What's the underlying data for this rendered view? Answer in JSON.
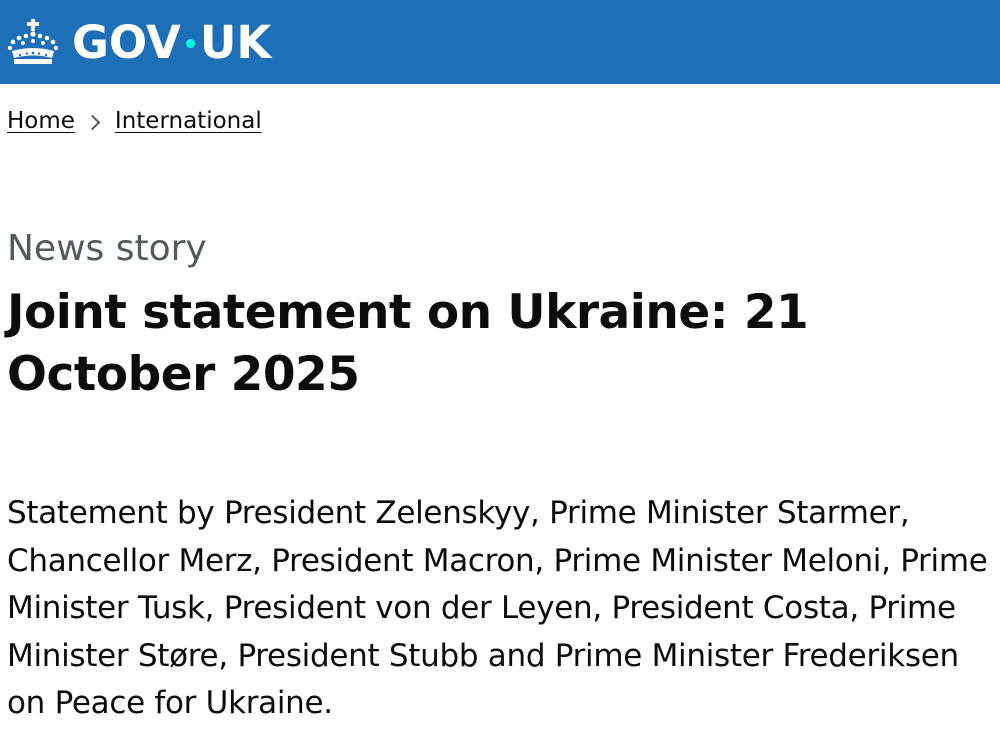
{
  "header": {
    "logo_text_left": "GOV",
    "logo_text_right": "UK",
    "crown_icon": "crown-icon",
    "colors": {
      "header_bg": "#1d70b8",
      "logo_dot": "#00ffe0",
      "text": "#0b0c0c",
      "caption": "#505a5f"
    }
  },
  "breadcrumb": {
    "items": [
      {
        "label": "Home"
      },
      {
        "label": "International"
      }
    ],
    "separator_icon": "chevron-right-icon"
  },
  "article": {
    "caption": "News story",
    "title": "Joint statement on Ukraine: 21 October 2025",
    "summary": "Statement by President Zelenskyy, Prime Minister Starmer, Chancellor Merz, President Macron, Prime Minister Meloni, Prime Minister Tusk,  President von der Leyen, President Costa, Prime Minister Støre, President Stubb and Prime Minister Frederiksen on Peace for Ukraine."
  }
}
